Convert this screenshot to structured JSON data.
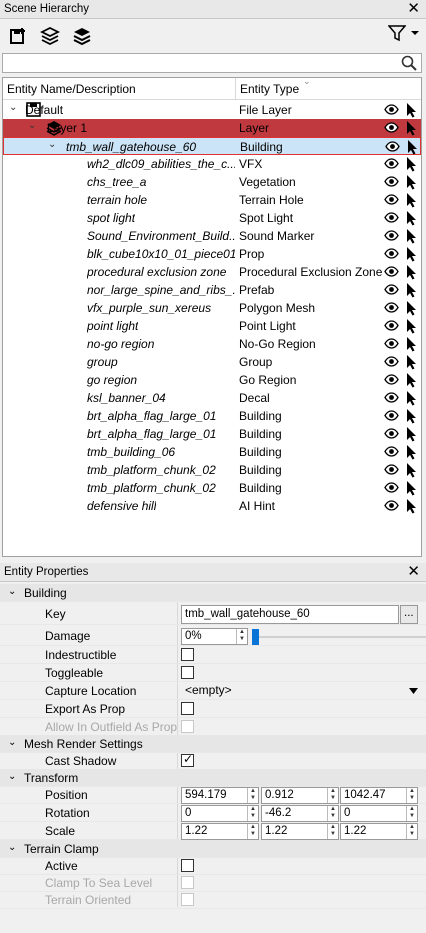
{
  "scene_hierarchy": {
    "title": "Scene Hierarchy",
    "search_value": "",
    "columns": [
      "Entity Name/Description",
      "Entity Type"
    ],
    "rows": [
      {
        "name": "Default",
        "type": "File Layer",
        "italic": false,
        "level": 0
      },
      {
        "name": "Layer 1",
        "type": "Layer",
        "italic": false,
        "level": 1
      },
      {
        "name": "tmb_wall_gatehouse_60",
        "type": "Building",
        "italic": true,
        "level": 2
      },
      {
        "name": "wh2_dlc09_abilities_the_c...",
        "type": "VFX",
        "italic": true,
        "level": 3
      },
      {
        "name": "chs_tree_a",
        "type": "Vegetation",
        "italic": true,
        "level": 3
      },
      {
        "name": "terrain hole",
        "type": "Terrain Hole",
        "italic": true,
        "level": 3
      },
      {
        "name": "spot light",
        "type": "Spot Light",
        "italic": true,
        "level": 3
      },
      {
        "name": "Sound_Environment_Build...",
        "type": "Sound Marker",
        "italic": true,
        "level": 3
      },
      {
        "name": "blk_cube10x10_01_piece01...",
        "type": "Prop",
        "italic": true,
        "level": 3
      },
      {
        "name": "procedural exclusion zone",
        "type": "Procedural Exclusion Zone",
        "italic": true,
        "level": 3
      },
      {
        "name": "nor_large_spine_and_ribs_...",
        "type": "Prefab",
        "italic": true,
        "level": 3
      },
      {
        "name": "vfx_purple_sun_xereus",
        "type": "Polygon Mesh",
        "italic": true,
        "level": 3
      },
      {
        "name": "point light",
        "type": "Point Light",
        "italic": true,
        "level": 3
      },
      {
        "name": "no-go region",
        "type": "No-Go Region",
        "italic": true,
        "level": 3
      },
      {
        "name": "group",
        "type": "Group",
        "italic": true,
        "level": 3
      },
      {
        "name": "go region",
        "type": "Go Region",
        "italic": true,
        "level": 3
      },
      {
        "name": "ksl_banner_04",
        "type": "Decal",
        "italic": true,
        "level": 3
      },
      {
        "name": "brt_alpha_flag_large_01",
        "type": "Building",
        "italic": true,
        "level": 3
      },
      {
        "name": "brt_alpha_flag_large_01",
        "type": "Building",
        "italic": true,
        "level": 3
      },
      {
        "name": "tmb_building_06",
        "type": "Building",
        "italic": true,
        "level": 3
      },
      {
        "name": "tmb_platform_chunk_02",
        "type": "Building",
        "italic": true,
        "level": 3
      },
      {
        "name": "tmb_platform_chunk_02",
        "type": "Building",
        "italic": true,
        "level": 3
      },
      {
        "name": "defensive hill",
        "type": "AI Hint",
        "italic": true,
        "level": 3
      }
    ]
  },
  "entity_properties": {
    "title": "Entity Properties",
    "building": {
      "section": "Building",
      "key_label": "Key",
      "key_value": "tmb_wall_gatehouse_60",
      "browse_label": "...",
      "damage_label": "Damage",
      "damage_value": "0%",
      "damage_fraction": 0.0,
      "indestructible_label": "Indestructible",
      "indestructible": false,
      "toggleable_label": "Toggleable",
      "toggleable": false,
      "capture_label": "Capture Location",
      "capture_value": "<empty>",
      "export_label": "Export As Prop",
      "export": false,
      "outfield_label": "Allow In Outfield As Prop",
      "outfield": false
    },
    "mesh": {
      "section": "Mesh Render Settings",
      "cast_shadow_label": "Cast Shadow",
      "cast_shadow": true
    },
    "transform": {
      "section": "Transform",
      "position_label": "Position",
      "position": [
        "594.179",
        "0.912",
        "1042.47"
      ],
      "rotation_label": "Rotation",
      "rotation": [
        "0",
        "-46.2",
        "0"
      ],
      "scale_label": "Scale",
      "scale": [
        "1.22",
        "1.22",
        "1.22"
      ]
    },
    "terrain": {
      "section": "Terrain Clamp",
      "active_label": "Active",
      "active": false,
      "clamp_label": "Clamp To Sea Level",
      "oriented_label": "Terrain Oriented"
    }
  }
}
